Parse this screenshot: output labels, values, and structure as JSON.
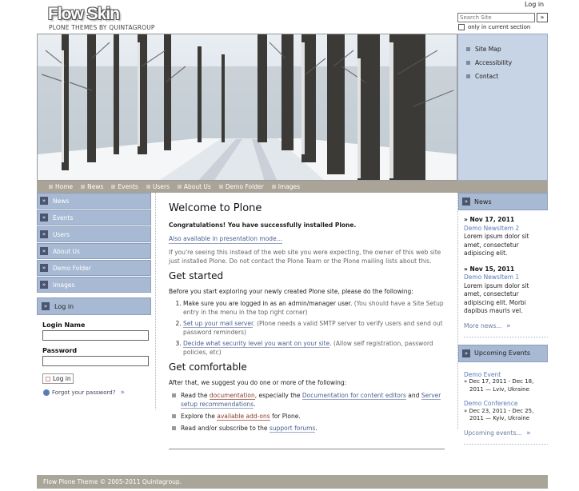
{
  "header": {
    "logo": "Flow Skin",
    "tagline": "PLONE THEMES BY QUINTAGROUP",
    "login_link": "Log in",
    "search_placeholder": "Search Site",
    "search_button": "»",
    "only_current": "only in current section"
  },
  "site_actions": [
    "Site Map",
    "Accessibility",
    "Contact"
  ],
  "nav": [
    "Home",
    "News",
    "Events",
    "Users",
    "About Us",
    "Demo Folder",
    "Images"
  ],
  "left_nav": [
    "News",
    "Events",
    "Users",
    "About Us",
    "Demo Folder",
    "Images"
  ],
  "login": {
    "title": "Log in",
    "login_label": "Login Name",
    "password_label": "Password",
    "button": "Log in",
    "forgot": "Forgot your password?"
  },
  "main": {
    "title": "Welcome to Plone",
    "congrats": "Congratulations! You have successfully installed Plone.",
    "presentation": "Also available in presentation mode...",
    "intro": "If you're seeing this instead of the web site you were expecting, the owner of this web site just installed Plone. Do not contact the Plone Team or the Plone mailing lists about this.",
    "get_started": "Get started",
    "before": "Before you start exploring your newly created Plone site, please do the following:",
    "step1_a": "Make sure you are logged in as an admin/manager user.",
    "step1_b": "(You should have a Site Setup entry in the menu in the top right corner)",
    "step2_link": "Set up your mail server",
    "step2_rest": ". (Plone needs a valid SMTP server to verify users and send out password reminders)",
    "step3_link": "Decide what security level you want on your site",
    "step3_rest": ". (Allow self registration, password policies, etc)",
    "get_comfortable": "Get comfortable",
    "after": "After that, we suggest you do one or more of the following:",
    "b1_a": "Read the ",
    "b1_doc": "documentation",
    "b1_b": ", especially the ",
    "b1_editors": "Documentation for content editors",
    "b1_c": " and ",
    "b1_server": "Server setup recommendations",
    "b1_d": ".",
    "b2_a": "Explore the ",
    "b2_link": "available add-ons",
    "b2_b": " for Plone.",
    "b3_a": "Read and/or subscribe to the ",
    "b3_link": "support forums",
    "b3_b": "."
  },
  "news": {
    "title": "News",
    "items": [
      {
        "date": "» Nov 17, 2011",
        "title": "Demo NewsItem 2",
        "body": "Lorem ipsum dolor sit amet, consectetur adipiscing elit."
      },
      {
        "date": "» Nov 15, 2011",
        "title": "Demo NewsItem 1",
        "body": "Lorem ipsum dolor sit amet, consectetur adipiscing elit. Morbi dapibus mauris vel."
      }
    ],
    "more": "More news..."
  },
  "events": {
    "title": "Upcoming Events",
    "items": [
      {
        "title": "Demo Event",
        "l1": "» Dec 17, 2011 - Dec 18,",
        "l2": "2011 — Lviv, Ukraine"
      },
      {
        "title": "Demo Conference",
        "l1": "» Dec 23, 2011 - Dec 25,",
        "l2": "2011 — Kyiv, Ukraine"
      }
    ],
    "more": "Upcoming events..."
  },
  "footer": "Flow Plone Theme © 2005-2011 Quintagroup."
}
